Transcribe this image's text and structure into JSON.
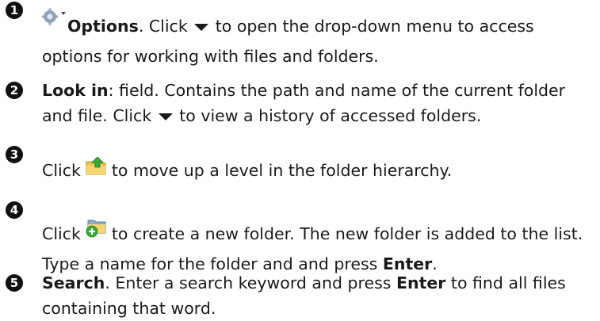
{
  "items": [
    {
      "number": "1",
      "bold": "Options",
      "t1": ". Click ",
      "t2": " to open the drop-down menu to access options for working with files and folders.",
      "icon": "gear-dropdown-icon"
    },
    {
      "number": "2",
      "bold": "Look in",
      "t1": ": field. Contains the path and name of the current folder and file. Click ",
      "t2": " to view a history of accessed folders."
    },
    {
      "number": "3",
      "t1": "Click ",
      "t2": " to move up a level in the folder hierarchy.",
      "icon": "folder-up-icon"
    },
    {
      "number": "4",
      "t1": "Click ",
      "t2": " to create a new folder. The new folder is added to the list. Type a name for the folder and and press ",
      "bold_end": "Enter",
      "t3": ".",
      "icon": "new-folder-icon"
    },
    {
      "number": "5",
      "bold": "Search",
      "t1": ". Enter a search keyword and press ",
      "bold_mid": "Enter",
      "t2": " to find all files containing that word."
    }
  ],
  "icons": {
    "dropdown": "down-triangle-icon"
  },
  "colors": {
    "folder": "#e8c34d",
    "arrow_green": "#3aa83a",
    "gear": "#8fa3b8"
  }
}
